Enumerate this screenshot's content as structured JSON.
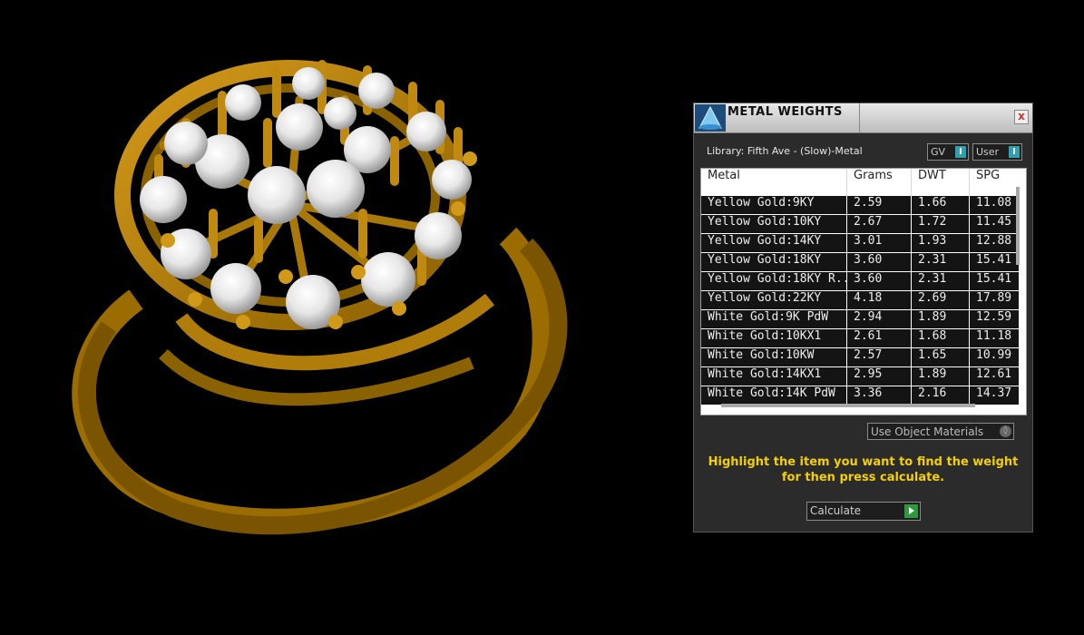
{
  "dialog": {
    "title": "METAL WEIGHTS",
    "close_label": "x",
    "library_label": "Library: Fifth Ave - (Slow)-Metal",
    "gv_toggle": "GV",
    "user_toggle": "User",
    "toggle_knob": "I",
    "columns": [
      "Metal",
      "Grams",
      "DWT",
      "SPG"
    ],
    "rows": [
      [
        "Yellow Gold:9KY",
        "2.59",
        "1.66",
        "11.08"
      ],
      [
        "Yellow Gold:10KY",
        "2.67",
        "1.72",
        "11.45"
      ],
      [
        "Yellow Gold:14KY",
        "3.01",
        "1.93",
        "12.88"
      ],
      [
        "Yellow Gold:18KY",
        "3.60",
        "2.31",
        "15.41"
      ],
      [
        "Yellow Gold:18KY R...",
        "3.60",
        "2.31",
        "15.41"
      ],
      [
        "Yellow Gold:22KY",
        "4.18",
        "2.69",
        "17.89"
      ],
      [
        "White Gold:9K PdW",
        "2.94",
        "1.89",
        "12.59"
      ],
      [
        "White Gold:10KX1",
        "2.61",
        "1.68",
        "11.18"
      ],
      [
        "White Gold:10KW",
        "2.57",
        "1.65",
        "10.99"
      ],
      [
        "White Gold:14KX1",
        "2.95",
        "1.89",
        "12.61"
      ],
      [
        "White Gold:14K PdW",
        "3.36",
        "2.16",
        "14.37"
      ]
    ],
    "materials_select": "Use Object Materials",
    "hint_line1": "Highlight the item you want to find the weight",
    "hint_line2": "for then press calculate.",
    "calculate_label": "Calculate"
  },
  "colors": {
    "gold": "#b8860b",
    "hint": "#f5d000",
    "accent": "#2fa0b0",
    "go": "#2c9a3a"
  }
}
